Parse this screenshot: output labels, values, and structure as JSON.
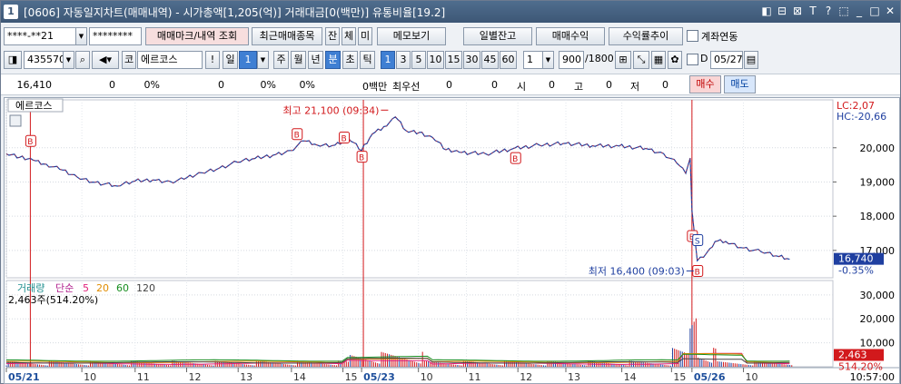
{
  "window": {
    "number": "1",
    "title": "[0606] 자동일지차트(매매내역) - 시가총액[1,205(억)] 거래대금[0(백만)] 유통비율[19.2]",
    "btns": [
      "◧",
      "⊟",
      "⊠",
      "T",
      "?",
      "⬚",
      "_",
      "□",
      "✕"
    ]
  },
  "row1": {
    "account": "****-**21",
    "password": "********",
    "btn_trade_mark": "매매마크/내역 조회",
    "btn_recent": "최근매매종목",
    "btn_jan": "잔",
    "btn_che": "체",
    "btn_mi": "미",
    "btn_memo": "메모보기",
    "btn_daily": "일별잔고",
    "btn_profit": "매매수익",
    "btn_ratio": "수익률추이",
    "chk_link": "계좌연동"
  },
  "row2": {
    "code": "435570",
    "code_prefix": "코",
    "stock_name": "에르코스",
    "period_il": "일",
    "period_num": "1",
    "periods": [
      "주",
      "월",
      "년",
      "분",
      "초",
      "틱"
    ],
    "active_period": "분",
    "minutes": [
      "1",
      "3",
      "5",
      "10",
      "15",
      "30",
      "45",
      "60"
    ],
    "active_minute": "1",
    "count_select": "1",
    "count": "900",
    "count_total": "/1800",
    "chk_d": "D",
    "date": "05/27"
  },
  "row3": {
    "price": "16,410",
    "v1": "0",
    "p1": "0%",
    "v2": "0",
    "p2": "0%",
    "p3": "0%",
    "unit": "0백만",
    "best": "최우선",
    "v3": "0",
    "v4": "0",
    "lbl_si": "시",
    "v5": "0",
    "lbl_go": "고",
    "v6": "0",
    "lbl_jeo": "저",
    "v7": "0",
    "btn_buy": "매수",
    "btn_sell": "매도"
  },
  "chart_data": {
    "type": "line",
    "stock": "에르코스",
    "price_ticks": [
      "20,000",
      "19,000",
      "18,000",
      "17,000"
    ],
    "vol_ticks": [
      "30,000",
      "20,000",
      "10,000"
    ],
    "lc": "LC:2,07",
    "hc": "HC:-20,66",
    "last_price_tag": "16,740",
    "last_change_tag": "-0.35%",
    "high_label": "최고 21,100 (09:34)",
    "low_label": "최저 16,400 (09:03)",
    "vol_legend": {
      "title": "거래량",
      "ma": "단순",
      "ma_vals": [
        "5",
        "20",
        "60",
        "120"
      ],
      "sub": "2,463주(514.20%)",
      "colors": [
        "#e0207a",
        "#e08c00",
        "#178d1f",
        "#444444"
      ]
    },
    "vol_last_tag": "2,463",
    "vol_pct_tag": "514.20%",
    "x_labels": [
      {
        "t": "05/21",
        "bold": true
      },
      {
        "t": "10"
      },
      {
        "t": "11"
      },
      {
        "t": "12"
      },
      {
        "t": "13"
      },
      {
        "t": "14"
      },
      {
        "t": "15"
      },
      {
        "t": "05/23",
        "bold": true
      },
      {
        "t": "10"
      },
      {
        "t": "11"
      },
      {
        "t": "12"
      },
      {
        "t": "13"
      },
      {
        "t": "14"
      },
      {
        "t": "15"
      },
      {
        "t": "05/26",
        "bold": true
      },
      {
        "t": "10"
      }
    ],
    "time_tag": "10:57:00",
    "ylim": [
      16200,
      21400
    ],
    "price_series": [
      [
        0,
        19820
      ],
      [
        15,
        19720
      ],
      [
        30,
        19640
      ],
      [
        45,
        19520
      ],
      [
        60,
        19370
      ],
      [
        80,
        19140
      ],
      [
        100,
        18990
      ],
      [
        125,
        18880
      ],
      [
        145,
        19030
      ],
      [
        165,
        19060
      ],
      [
        185,
        19010
      ],
      [
        200,
        19080
      ],
      [
        220,
        19270
      ],
      [
        240,
        19410
      ],
      [
        260,
        19580
      ],
      [
        280,
        19690
      ],
      [
        300,
        19780
      ],
      [
        320,
        19920
      ],
      [
        335,
        20200
      ],
      [
        350,
        20080
      ],
      [
        370,
        20080
      ],
      [
        385,
        20280
      ],
      [
        400,
        19920
      ],
      [
        412,
        20400
      ],
      [
        425,
        20620
      ],
      [
        438,
        20900
      ],
      [
        450,
        20500
      ],
      [
        465,
        20450
      ],
      [
        480,
        20300
      ],
      [
        495,
        19940
      ],
      [
        510,
        19870
      ],
      [
        540,
        19820
      ],
      [
        570,
        19970
      ],
      [
        600,
        20080
      ],
      [
        630,
        20130
      ],
      [
        660,
        20060
      ],
      [
        690,
        20050
      ],
      [
        720,
        19980
      ],
      [
        740,
        19830
      ],
      [
        755,
        19550
      ],
      [
        765,
        19250
      ],
      [
        770,
        19700
      ],
      [
        772,
        18180
      ],
      [
        778,
        16700
      ],
      [
        785,
        16800
      ],
      [
        792,
        17050
      ],
      [
        798,
        17260
      ],
      [
        810,
        17260
      ],
      [
        830,
        17070
      ],
      [
        850,
        16960
      ],
      [
        870,
        16820
      ],
      [
        882,
        16740
      ]
    ],
    "buy_marks": [
      [
        27,
        20200
      ],
      [
        327,
        20400
      ],
      [
        380,
        20300
      ],
      [
        400,
        19740
      ],
      [
        573,
        19700
      ],
      [
        772,
        17420
      ],
      [
        778,
        16400
      ]
    ],
    "sell_marks": [
      [
        778,
        17300
      ]
    ],
    "trade_lines": [
      27,
      402,
      772
    ]
  }
}
